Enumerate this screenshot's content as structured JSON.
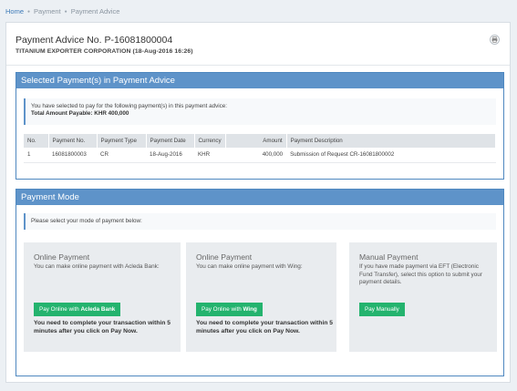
{
  "breadcrumb": {
    "home": "Home",
    "item1": "Payment",
    "item2": "Payment Advice"
  },
  "header": {
    "title": "Payment Advice No. P-16081800004",
    "subtitle": "TITANIUM EXPORTER CORPORATION (18-Aug-2016 16:26)"
  },
  "selected": {
    "heading": "Selected Payment(s) in Payment Advice",
    "notice": "You have selected to pay for the following payment(s) in this payment advice:",
    "total": "Total Amount Payable: KHR 400,000",
    "columns": [
      "No.",
      "Payment No.",
      "Payment Type",
      "Payment Date",
      "Currency",
      "Amount",
      "Payment Description"
    ],
    "rows": [
      {
        "no": "1",
        "payment_no": "16081800003",
        "type": "CR",
        "date": "18-Aug-2016",
        "currency": "KHR",
        "amount": "400,000",
        "description": "Submission of Request CR-16081800002"
      }
    ]
  },
  "mode": {
    "heading": "Payment Mode",
    "notice": "Please select your mode of payment below:",
    "cards": [
      {
        "title": "Online Payment",
        "desc": "You can make online payment with Acleda Bank:",
        "button_prefix": "Pay Online with ",
        "button_bold": "Acleda Bank",
        "warning": "You need to complete your transaction within 5 minutes after you click on Pay Now."
      },
      {
        "title": "Online Payment",
        "desc": "You can make online payment with Wing:",
        "button_prefix": "Pay Online with ",
        "button_bold": "Wing",
        "warning": "You need to complete your transaction within 5 minutes after you click on Pay Now."
      },
      {
        "title": "Manual Payment",
        "desc": "If you have made payment via EFT (Electronic Fund Transfer), select this option to submit your payment details.",
        "button": "Pay Manually"
      }
    ]
  },
  "colors": {
    "accent": "#5e93c9",
    "button": "#24b36e",
    "link": "#3d7ab8"
  },
  "icons": {
    "print": "print-icon"
  }
}
